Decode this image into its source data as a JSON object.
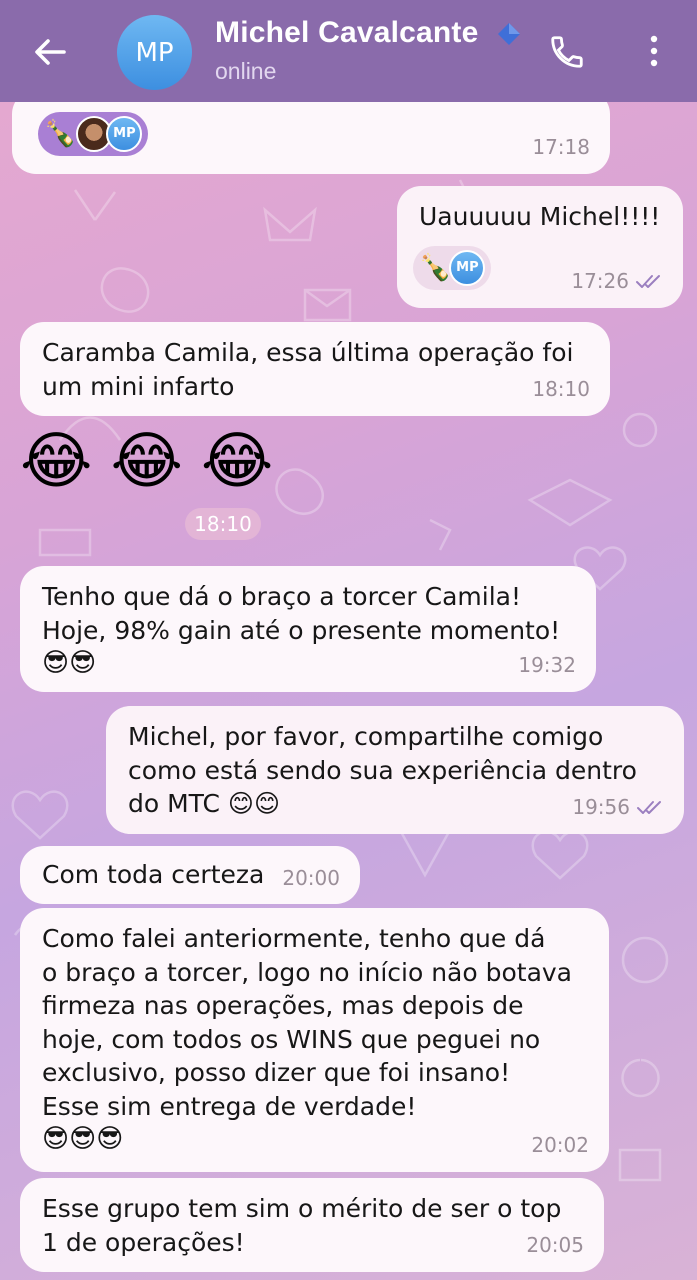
{
  "header": {
    "contact_name": "Michel Cavalcante",
    "status": "online",
    "avatar_initials": "MP",
    "colors": {
      "bar": "#8a6bab",
      "avatar": "#4a9be6",
      "verified": "#3f6fd8"
    }
  },
  "messages": [
    {
      "id": "m1",
      "direction": "in",
      "text": "",
      "time": "17:18",
      "reaction": {
        "emoji": "🍾",
        "avatar_initials": "MP"
      }
    },
    {
      "id": "m2",
      "direction": "out",
      "text": "Uauuuuu Michel!!!!",
      "time": "17:26",
      "read": true,
      "reaction": {
        "emoji": "🍾",
        "avatar_initials": "MP"
      }
    },
    {
      "id": "m3",
      "direction": "in",
      "text": "Caramba Camila, essa última operação foi\num mini infarto",
      "time": "18:10"
    },
    {
      "id": "m4",
      "direction": "in",
      "text": "😂😂😂",
      "time": "18:10"
    },
    {
      "id": "m5",
      "direction": "in",
      "text": "Tenho que dá o braço a torcer Camila!\nHoje, 98% gain até o presente momento!",
      "emojis": "😎😎",
      "time": "19:32"
    },
    {
      "id": "m6",
      "direction": "out",
      "text": "Michel, por favor, compartilhe comigo\ncomo está sendo sua experiência dentro\ndo MTC 😊😊",
      "time": "19:56",
      "read": true
    },
    {
      "id": "m7",
      "direction": "in",
      "text": "Com toda certeza",
      "time": "20:00"
    },
    {
      "id": "m8",
      "direction": "in",
      "text": "Como falei anteriormente, tenho que dá\no braço a torcer, logo no início não botava\nfirmeza nas operações, mas depois de\nhoje, com todos os WINS que peguei no\nexclusivo, posso dizer que foi insano!\nEsse sim entrega de verdade!",
      "emojis": "😎😎😎",
      "time": "20:02"
    },
    {
      "id": "m9",
      "direction": "in",
      "text": "Esse grupo tem sim o mérito de ser o top\n1 de operações!",
      "time": "20:05"
    }
  ]
}
